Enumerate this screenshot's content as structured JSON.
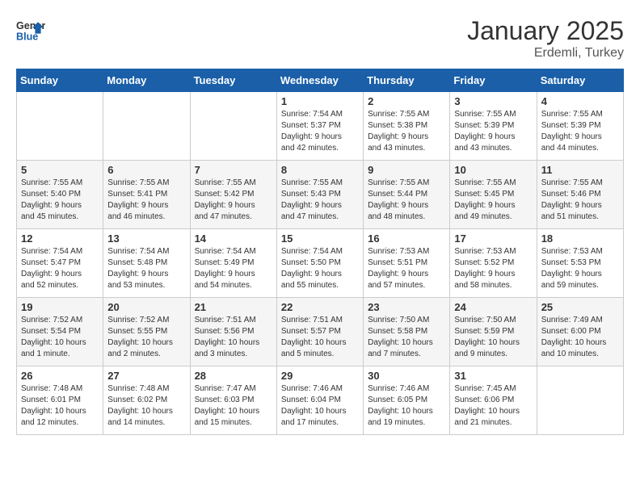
{
  "header": {
    "logo_line1": "General",
    "logo_line2": "Blue",
    "title": "January 2025",
    "subtitle": "Erdemli, Turkey"
  },
  "days_of_week": [
    "Sunday",
    "Monday",
    "Tuesday",
    "Wednesday",
    "Thursday",
    "Friday",
    "Saturday"
  ],
  "weeks": [
    [
      {
        "day": "",
        "info": ""
      },
      {
        "day": "",
        "info": ""
      },
      {
        "day": "",
        "info": ""
      },
      {
        "day": "1",
        "info": "Sunrise: 7:54 AM\nSunset: 5:37 PM\nDaylight: 9 hours\nand 42 minutes."
      },
      {
        "day": "2",
        "info": "Sunrise: 7:55 AM\nSunset: 5:38 PM\nDaylight: 9 hours\nand 43 minutes."
      },
      {
        "day": "3",
        "info": "Sunrise: 7:55 AM\nSunset: 5:39 PM\nDaylight: 9 hours\nand 43 minutes."
      },
      {
        "day": "4",
        "info": "Sunrise: 7:55 AM\nSunset: 5:39 PM\nDaylight: 9 hours\nand 44 minutes."
      }
    ],
    [
      {
        "day": "5",
        "info": "Sunrise: 7:55 AM\nSunset: 5:40 PM\nDaylight: 9 hours\nand 45 minutes."
      },
      {
        "day": "6",
        "info": "Sunrise: 7:55 AM\nSunset: 5:41 PM\nDaylight: 9 hours\nand 46 minutes."
      },
      {
        "day": "7",
        "info": "Sunrise: 7:55 AM\nSunset: 5:42 PM\nDaylight: 9 hours\nand 47 minutes."
      },
      {
        "day": "8",
        "info": "Sunrise: 7:55 AM\nSunset: 5:43 PM\nDaylight: 9 hours\nand 47 minutes."
      },
      {
        "day": "9",
        "info": "Sunrise: 7:55 AM\nSunset: 5:44 PM\nDaylight: 9 hours\nand 48 minutes."
      },
      {
        "day": "10",
        "info": "Sunrise: 7:55 AM\nSunset: 5:45 PM\nDaylight: 9 hours\nand 49 minutes."
      },
      {
        "day": "11",
        "info": "Sunrise: 7:55 AM\nSunset: 5:46 PM\nDaylight: 9 hours\nand 51 minutes."
      }
    ],
    [
      {
        "day": "12",
        "info": "Sunrise: 7:54 AM\nSunset: 5:47 PM\nDaylight: 9 hours\nand 52 minutes."
      },
      {
        "day": "13",
        "info": "Sunrise: 7:54 AM\nSunset: 5:48 PM\nDaylight: 9 hours\nand 53 minutes."
      },
      {
        "day": "14",
        "info": "Sunrise: 7:54 AM\nSunset: 5:49 PM\nDaylight: 9 hours\nand 54 minutes."
      },
      {
        "day": "15",
        "info": "Sunrise: 7:54 AM\nSunset: 5:50 PM\nDaylight: 9 hours\nand 55 minutes."
      },
      {
        "day": "16",
        "info": "Sunrise: 7:53 AM\nSunset: 5:51 PM\nDaylight: 9 hours\nand 57 minutes."
      },
      {
        "day": "17",
        "info": "Sunrise: 7:53 AM\nSunset: 5:52 PM\nDaylight: 9 hours\nand 58 minutes."
      },
      {
        "day": "18",
        "info": "Sunrise: 7:53 AM\nSunset: 5:53 PM\nDaylight: 9 hours\nand 59 minutes."
      }
    ],
    [
      {
        "day": "19",
        "info": "Sunrise: 7:52 AM\nSunset: 5:54 PM\nDaylight: 10 hours\nand 1 minute."
      },
      {
        "day": "20",
        "info": "Sunrise: 7:52 AM\nSunset: 5:55 PM\nDaylight: 10 hours\nand 2 minutes."
      },
      {
        "day": "21",
        "info": "Sunrise: 7:51 AM\nSunset: 5:56 PM\nDaylight: 10 hours\nand 3 minutes."
      },
      {
        "day": "22",
        "info": "Sunrise: 7:51 AM\nSunset: 5:57 PM\nDaylight: 10 hours\nand 5 minutes."
      },
      {
        "day": "23",
        "info": "Sunrise: 7:50 AM\nSunset: 5:58 PM\nDaylight: 10 hours\nand 7 minutes."
      },
      {
        "day": "24",
        "info": "Sunrise: 7:50 AM\nSunset: 5:59 PM\nDaylight: 10 hours\nand 9 minutes."
      },
      {
        "day": "25",
        "info": "Sunrise: 7:49 AM\nSunset: 6:00 PM\nDaylight: 10 hours\nand 10 minutes."
      }
    ],
    [
      {
        "day": "26",
        "info": "Sunrise: 7:48 AM\nSunset: 6:01 PM\nDaylight: 10 hours\nand 12 minutes."
      },
      {
        "day": "27",
        "info": "Sunrise: 7:48 AM\nSunset: 6:02 PM\nDaylight: 10 hours\nand 14 minutes."
      },
      {
        "day": "28",
        "info": "Sunrise: 7:47 AM\nSunset: 6:03 PM\nDaylight: 10 hours\nand 15 minutes."
      },
      {
        "day": "29",
        "info": "Sunrise: 7:46 AM\nSunset: 6:04 PM\nDaylight: 10 hours\nand 17 minutes."
      },
      {
        "day": "30",
        "info": "Sunrise: 7:46 AM\nSunset: 6:05 PM\nDaylight: 10 hours\nand 19 minutes."
      },
      {
        "day": "31",
        "info": "Sunrise: 7:45 AM\nSunset: 6:06 PM\nDaylight: 10 hours\nand 21 minutes."
      },
      {
        "day": "",
        "info": ""
      }
    ]
  ]
}
